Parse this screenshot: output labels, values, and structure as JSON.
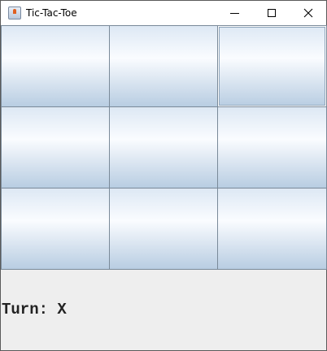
{
  "window": {
    "title": "Tic-Tac-Toe",
    "icon": "java-cup-icon",
    "controls": [
      "minimize",
      "maximize",
      "close"
    ]
  },
  "board": {
    "cells": [
      "",
      "",
      "",
      "",
      "",
      "",
      "",
      "",
      ""
    ],
    "focused_cell": 2
  },
  "status": {
    "text": "Turn: X"
  }
}
